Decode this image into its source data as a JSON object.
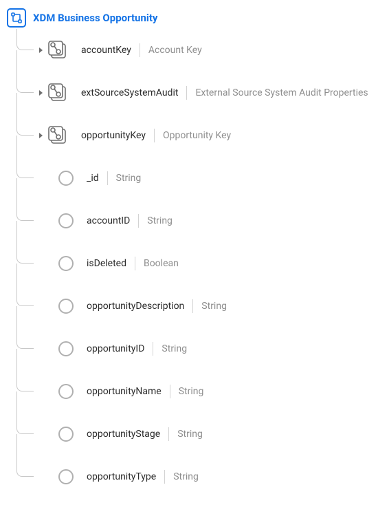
{
  "root": {
    "title": "XDM Business Opportunity"
  },
  "fields": [
    {
      "name": "accountKey",
      "type": "Account Key",
      "expandable": true,
      "icon": "object"
    },
    {
      "name": "extSourceSystemAudit",
      "type": "External Source System Audit Properties",
      "expandable": true,
      "icon": "object"
    },
    {
      "name": "opportunityKey",
      "type": "Opportunity Key",
      "expandable": true,
      "icon": "object"
    },
    {
      "name": "_id",
      "type": "String",
      "expandable": false,
      "icon": "leaf"
    },
    {
      "name": "accountID",
      "type": "String",
      "expandable": false,
      "icon": "leaf"
    },
    {
      "name": "isDeleted",
      "type": "Boolean",
      "expandable": false,
      "icon": "leaf"
    },
    {
      "name": "opportunityDescription",
      "type": "String",
      "expandable": false,
      "icon": "leaf"
    },
    {
      "name": "opportunityID",
      "type": "String",
      "expandable": false,
      "icon": "leaf"
    },
    {
      "name": "opportunityName",
      "type": "String",
      "expandable": false,
      "icon": "leaf"
    },
    {
      "name": "opportunityStage",
      "type": "String",
      "expandable": false,
      "icon": "leaf"
    },
    {
      "name": "opportunityType",
      "type": "String",
      "expandable": false,
      "icon": "leaf"
    }
  ]
}
